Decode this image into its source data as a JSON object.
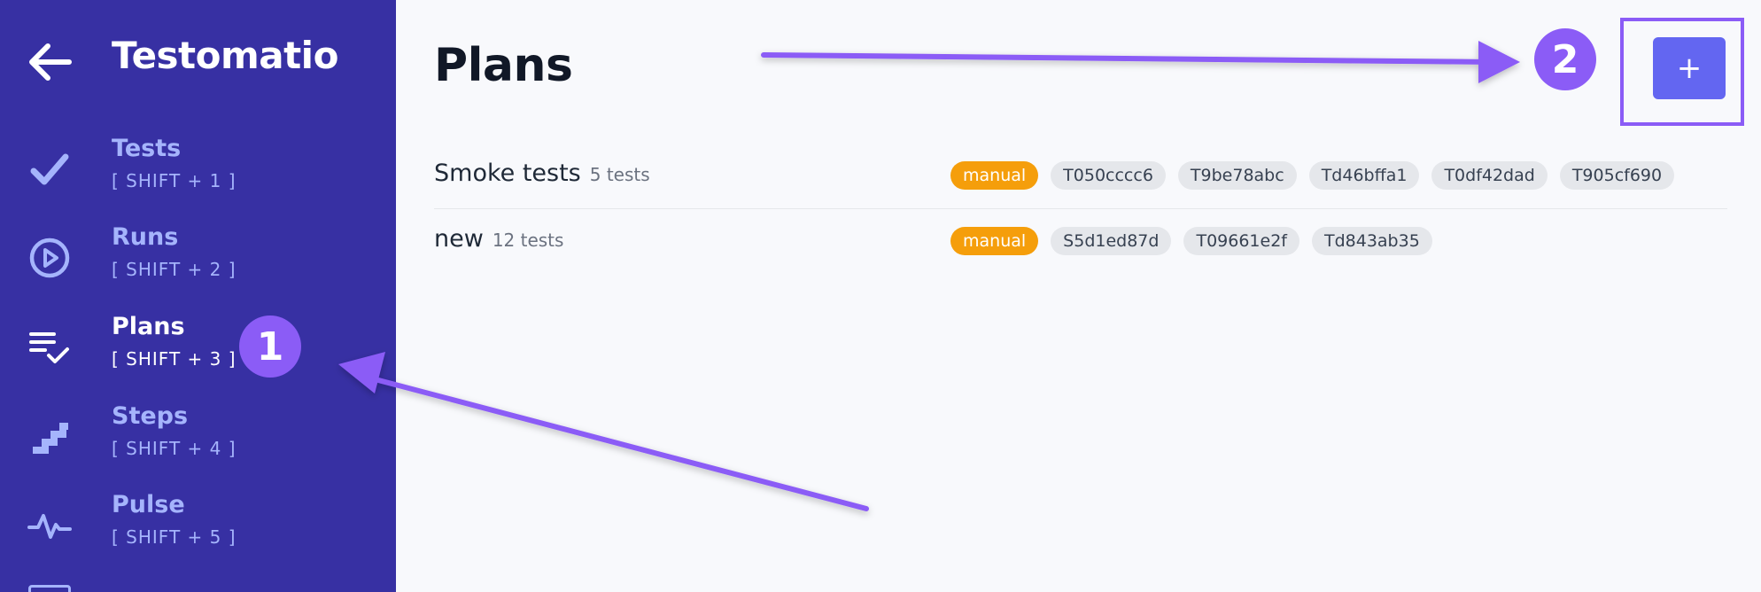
{
  "app": {
    "title": "Testomatio"
  },
  "sidebar": {
    "items": [
      {
        "label": "Tests",
        "shortcut": "[ SHIFT + 1 ]",
        "icon": "check-icon",
        "active": false
      },
      {
        "label": "Runs",
        "shortcut": "[ SHIFT + 2 ]",
        "icon": "play-circle-icon",
        "active": false
      },
      {
        "label": "Plans",
        "shortcut": "[ SHIFT + 3 ]",
        "icon": "list-check-icon",
        "active": true
      },
      {
        "label": "Steps",
        "shortcut": "[ SHIFT + 4 ]",
        "icon": "stairs-icon",
        "active": false
      },
      {
        "label": "Pulse",
        "shortcut": "[ SHIFT + 5 ]",
        "icon": "pulse-icon",
        "active": false
      }
    ]
  },
  "main": {
    "title": "Plans",
    "add_button_label": "+",
    "plans": [
      {
        "name": "Smoke tests",
        "count": "5 tests",
        "tags": [
          "manual",
          "T050cccc6",
          "T9be78abc",
          "Td46bffa1",
          "T0df42dad",
          "T905cf690"
        ]
      },
      {
        "name": "new",
        "count": "12 tests",
        "tags": [
          "manual",
          "S5d1ed87d",
          "T09661e2f",
          "Td843ab35"
        ]
      }
    ]
  },
  "annotations": {
    "step1": "1",
    "step2": "2"
  },
  "colors": {
    "sidebar_bg": "#3730a3",
    "sidebar_text": "#a5b4fc",
    "accent_button": "#6366f1",
    "annotation": "#8b5cf6",
    "manual_tag": "#f59e0b",
    "test_tag": "#e5e7eb"
  }
}
